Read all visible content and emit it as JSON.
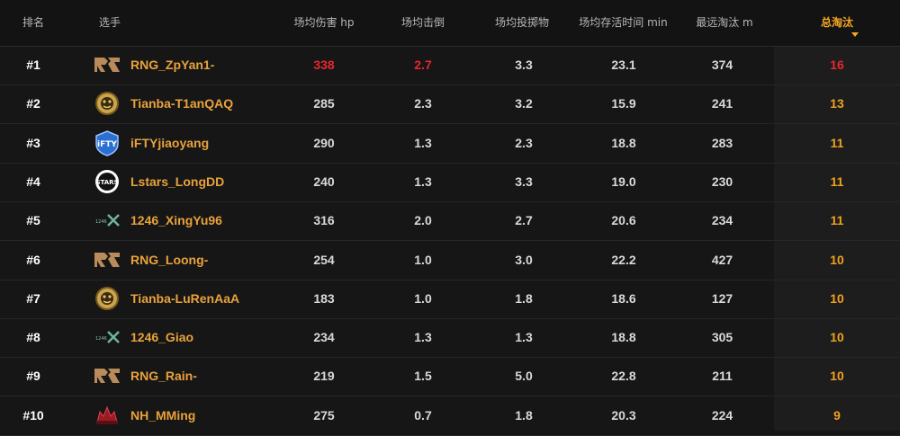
{
  "header": {
    "rank": "排名",
    "player": "选手",
    "damage": "场均伤害 hp",
    "kills": "场均击倒",
    "throwables": "场均投掷物",
    "survival": "场均存活时间 min",
    "longest": "最远淘汰 m",
    "total_kills": "总淘汰"
  },
  "sort": {
    "column": "total_kills",
    "direction": "descending"
  },
  "colors": {
    "accent": "#f5a623",
    "player_name": "#e9a23b",
    "highlight_red": "#e8262f",
    "top_total": "#e8262f"
  },
  "rows": [
    {
      "rank": "#1",
      "team": "RNG",
      "logo": "rng-logo",
      "player": "RNG_ZpYan1-",
      "damage": "338",
      "kills": "2.7",
      "throwables": "3.3",
      "survival": "23.1",
      "longest": "374",
      "total": "16",
      "highlight": {
        "damage": true,
        "kills": true,
        "total": true
      }
    },
    {
      "rank": "#2",
      "team": "Tianba",
      "logo": "tianba-logo",
      "player": "Tianba-T1anQAQ",
      "damage": "285",
      "kills": "2.3",
      "throwables": "3.2",
      "survival": "15.9",
      "longest": "241",
      "total": "13",
      "highlight": {}
    },
    {
      "rank": "#3",
      "team": "iFTY",
      "logo": "ifty-logo",
      "player": "iFTYjiaoyang",
      "damage": "290",
      "kills": "1.3",
      "throwables": "2.3",
      "survival": "18.8",
      "longest": "283",
      "total": "11",
      "highlight": {}
    },
    {
      "rank": "#4",
      "team": "Lstars",
      "logo": "lstars-logo",
      "player": "Lstars_LongDD",
      "damage": "240",
      "kills": "1.3",
      "throwables": "3.3",
      "survival": "19.0",
      "longest": "230",
      "total": "11",
      "highlight": {}
    },
    {
      "rank": "#5",
      "team": "1246",
      "logo": "1246-logo",
      "player": "1246_XingYu96",
      "damage": "316",
      "kills": "2.0",
      "throwables": "2.7",
      "survival": "20.6",
      "longest": "234",
      "total": "11",
      "highlight": {}
    },
    {
      "rank": "#6",
      "team": "RNG",
      "logo": "rng-logo",
      "player": "RNG_Loong-",
      "damage": "254",
      "kills": "1.0",
      "throwables": "3.0",
      "survival": "22.2",
      "longest": "427",
      "total": "10",
      "highlight": {}
    },
    {
      "rank": "#7",
      "team": "Tianba",
      "logo": "tianba-logo",
      "player": "Tianba-LuRenAaA",
      "damage": "183",
      "kills": "1.0",
      "throwables": "1.8",
      "survival": "18.6",
      "longest": "127",
      "total": "10",
      "highlight": {}
    },
    {
      "rank": "#8",
      "team": "1246",
      "logo": "1246-logo",
      "player": "1246_Giao",
      "damage": "234",
      "kills": "1.3",
      "throwables": "1.3",
      "survival": "18.8",
      "longest": "305",
      "total": "10",
      "highlight": {}
    },
    {
      "rank": "#9",
      "team": "RNG",
      "logo": "rng-logo",
      "player": "RNG_Rain-",
      "damage": "219",
      "kills": "1.5",
      "throwables": "5.0",
      "survival": "22.8",
      "longest": "211",
      "total": "10",
      "highlight": {}
    },
    {
      "rank": "#10",
      "team": "NH",
      "logo": "nh-logo",
      "player": "NH_MMing",
      "damage": "275",
      "kills": "0.7",
      "throwables": "1.8",
      "survival": "20.3",
      "longest": "224",
      "total": "9",
      "highlight": {}
    }
  ]
}
